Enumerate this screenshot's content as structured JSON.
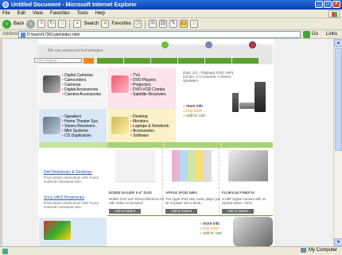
{
  "window": {
    "title": "Untitled Document - Microsoft Internet Explorer",
    "btn_min": "_",
    "btn_max": "□",
    "btn_close": "×"
  },
  "menu": [
    "File",
    "Edit",
    "View",
    "Favorites",
    "Tools",
    "Help"
  ],
  "toolbar": {
    "back_label": "Back",
    "search_label": "Search",
    "favorites_label": "Favorites"
  },
  "address": {
    "label": "Address",
    "value": "D:\\tour\\#17301\\site\\index.html",
    "go_label": "Go",
    "links_label": "Links"
  },
  "site": {
    "tagline": "We use advanced technologies",
    "search_placeholder": "enter keyword"
  },
  "categories": {
    "electronics": [
      "Digital Cameras",
      "Camcorders",
      "Cameras",
      "Digital Accessories",
      "Camera Accessories"
    ],
    "video": [
      "TVs",
      "DVD Players",
      "Projectors",
      "DVD-VCR Combo",
      "Satellite Receivers"
    ],
    "audio": [
      "Speakers",
      "Home Theater Sys.",
      "Stereo Receivers",
      "Mini Systems",
      "CD Duplicators"
    ],
    "computers": [
      "Desktop",
      "Monitors",
      "Laptops & Notebook",
      "Accessories",
      "Software"
    ]
  },
  "hero": {
    "title": "DVD, CD - Playback DVD, MP3, CD-DA, 2.1 Channel, 2 Stereo Speakers",
    "links": [
      "more info",
      "buy now!",
      "add to cart"
    ]
  },
  "sidebar": {
    "link1": "Dell Notebooks & Desktops",
    "desc1": "Proin dictum elementum velit. Fusce euismod consequat ante.",
    "link2": "Sony VAIO Peripherals",
    "desc2": "Proin dictum elementum velit. Fusce euismod consequat ante."
  },
  "products": [
    {
      "name": "EDDIE BAUER 5.6\" DVD",
      "desc": "Mobile DVD and Videoconference Player with Video on Demand",
      "button": "Add to basket"
    },
    {
      "name": "APPLE IPOD MINI",
      "desc": "The Apple iPod mini music player packs a lot of power into a sleek...",
      "button": "Add to basket"
    },
    {
      "name": "FUJIFILM FINEPIX",
      "desc": "3.1MP Digital Camera with 3x Optical Zoom - F410",
      "button": "Add to basket"
    }
  ],
  "footer_links": [
    "more info",
    "buy now!",
    "add to cart"
  ],
  "status": {
    "zone": "My Computer"
  }
}
